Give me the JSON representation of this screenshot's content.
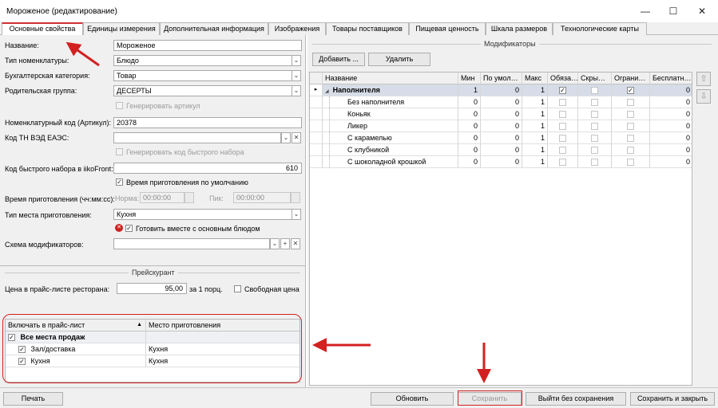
{
  "window": {
    "title": "Мороженое (редактирование)",
    "minimize": "—",
    "maximize": "☐",
    "close": "✕"
  },
  "tabs": [
    {
      "label": "Основные свойства",
      "active": true
    },
    {
      "label": "Единицы измерения"
    },
    {
      "label": "Дополнительная информация"
    },
    {
      "label": "Изображения"
    },
    {
      "label": "Товары поставщиков"
    },
    {
      "label": "Пищевая ценность"
    },
    {
      "label": "Шкала размеров"
    },
    {
      "label": "Технологические карты"
    }
  ],
  "form": {
    "name_label": "Название:",
    "name_value": "Мороженое",
    "type_label": "Тип номенклатуры:",
    "type_value": "Блюдо",
    "accounting_label": "Бухгалтерская категория:",
    "accounting_value": "Товар",
    "parent_label": "Родительская группа:",
    "parent_value": "ДЕСЕРТЫ",
    "gen_article_label": "Генерировать артикул",
    "article_label": "Номенклатурный код (Артикул):",
    "article_value": "20378",
    "tnved_label": "Код ТН ВЭД ЕАЭС:",
    "tnved_value": "",
    "gen_fastcode_label": "Генерировать код быстрого набора",
    "fastcode_label": "Код быстрого набора в iikoFront:",
    "fastcode_value": "610",
    "default_time_label": "Время приготовления по умолчанию",
    "cook_time_label": "Время приготовления (чч:мм:сс):",
    "norm_label": "Норма:",
    "norm_value": "00:00:00",
    "peak_label": "Пик:",
    "peak_value": "00:00:00",
    "place_type_label": "Тип места приготовления:",
    "place_type_value": "Кухня",
    "cook_with_main_label": "Готовить вместе с основным блюдом",
    "modifier_scheme_label": "Схема модификаторов:",
    "modifier_scheme_value": ""
  },
  "pricelist": {
    "section_title": "Прейскурант",
    "price_label": "Цена в прайс-листе ресторана:",
    "price_value": "95,00",
    "per_label": "за 1 порц.",
    "free_price_label": "Свободная цена",
    "col_include": "Включать в прайс-лист",
    "col_place": "Место приготовления",
    "rows": [
      {
        "name": "Все места продаж",
        "place": "",
        "bold": true
      },
      {
        "name": "Зал/доставка",
        "place": "Кухня"
      },
      {
        "name": "Кухня",
        "place": "Кухня"
      }
    ]
  },
  "modifiers": {
    "section_title": "Модификаторы",
    "add_button": "Добавить ...",
    "delete_button": "Удалить",
    "columns": [
      "Название",
      "Мин",
      "По умол…",
      "Макс",
      "Обяза…",
      "Скры…",
      "Ограни…",
      "Бесплатн…"
    ],
    "rows": [
      {
        "name": "Наполнителя",
        "min": "1",
        "def": "0",
        "max": "1",
        "req": true,
        "hidden": false,
        "limit": true,
        "free": "0",
        "group": true
      },
      {
        "name": "Без наполнителя",
        "min": "0",
        "def": "0",
        "max": "1",
        "req": false,
        "hidden": false,
        "limit": false,
        "free": "0"
      },
      {
        "name": "Коньяк",
        "min": "0",
        "def": "0",
        "max": "1",
        "req": false,
        "hidden": false,
        "limit": false,
        "free": "0"
      },
      {
        "name": "Ликер",
        "min": "0",
        "def": "0",
        "max": "1",
        "req": false,
        "hidden": false,
        "limit": false,
        "free": "0"
      },
      {
        "name": "С карамелью",
        "min": "0",
        "def": "0",
        "max": "1",
        "req": false,
        "hidden": false,
        "limit": false,
        "free": "0"
      },
      {
        "name": "С клубникой",
        "min": "0",
        "def": "0",
        "max": "1",
        "req": false,
        "hidden": false,
        "limit": false,
        "free": "0"
      },
      {
        "name": "С шоколадной крошкой",
        "min": "0",
        "def": "0",
        "max": "1",
        "req": false,
        "hidden": false,
        "limit": false,
        "free": "0"
      }
    ]
  },
  "bottom": {
    "print_button": "Печать",
    "refresh_button": "Обновить",
    "save_button": "Сохранить",
    "exit_button": "Выйти без сохранения",
    "save_close_button": "Сохранить и закрыть"
  },
  "glyphs": {
    "check": "✓",
    "dropdown": "⌄",
    "clear": "✕",
    "plus": "+",
    "sort_up": "▲",
    "expand": "◢",
    "row_pointer": "▸",
    "warning": "✕",
    "move_up": "⇧",
    "move_down": "⇩"
  },
  "colors": {
    "annotation_red": "#d32020",
    "selection": "#d6dde8",
    "active_tab_accent": "#d03030"
  }
}
